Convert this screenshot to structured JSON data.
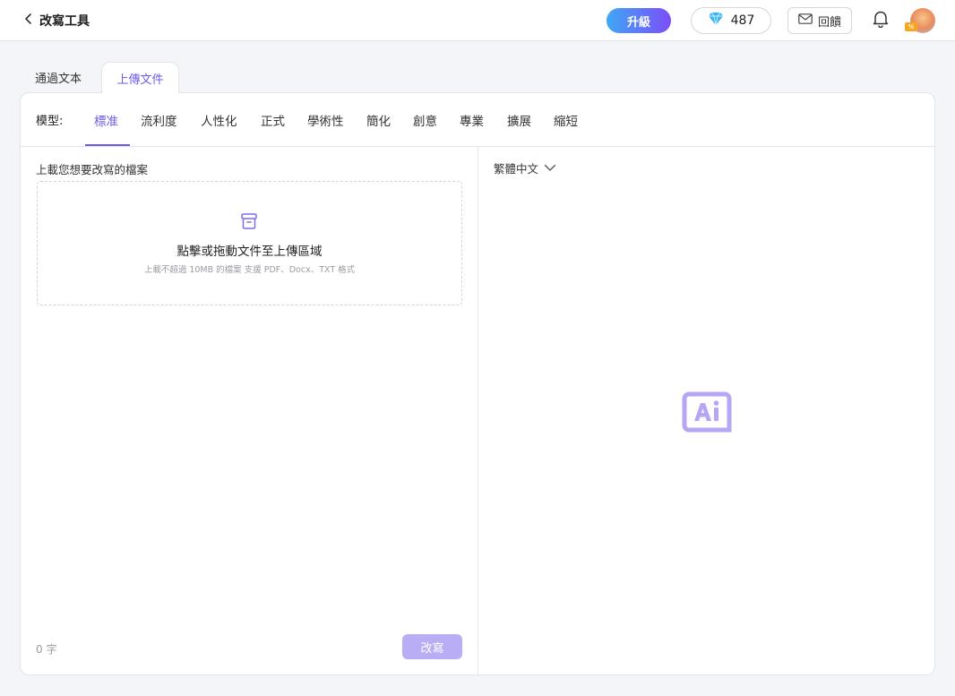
{
  "header": {
    "title": "改寫工具",
    "upgrade_label": "升級",
    "credits": "487",
    "feedback_label": "回饋",
    "avatar_badge": "%"
  },
  "tabs": [
    {
      "label": "通過文本",
      "active": false
    },
    {
      "label": "上傳文件",
      "active": true
    }
  ],
  "model": {
    "label": "模型:",
    "items": [
      {
        "label": "標准",
        "active": true
      },
      {
        "label": "流利度"
      },
      {
        "label": "人性化"
      },
      {
        "label": "正式"
      },
      {
        "label": "學術性"
      },
      {
        "label": "簡化"
      },
      {
        "label": "創意"
      },
      {
        "label": "專業"
      },
      {
        "label": "擴展"
      },
      {
        "label": "縮短"
      }
    ]
  },
  "upload": {
    "heading": "上載您想要改寫的檔案",
    "title": "點擊或拖動文件至上傳區域",
    "subtitle": "上載不超過 10MB 的檔案 支援 PDF、Docx、TXT 格式"
  },
  "footer": {
    "word_count": "0 字",
    "rewrite_label": "改寫"
  },
  "output": {
    "language": "繁體中文"
  },
  "colors": {
    "accent": "#6c5ce7",
    "button_disabled": "#b9aef6"
  }
}
